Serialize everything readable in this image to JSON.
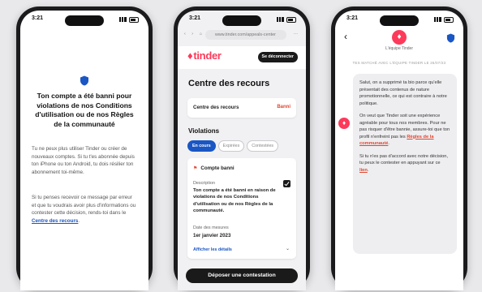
{
  "status": {
    "time": "3:21"
  },
  "phone1": {
    "title": "Ton compte a été banni pour violations de nos Conditions d'utilisation ou de nos Règles de la communauté",
    "para1": "Tu ne peux plus utiliser Tinder ou créer de nouveaux comptes. Si tu t'es abonnée depuis ton iPhone ou ton Android, tu dois résilier ton abonnement toi-même.",
    "para2_text": "Si tu penses recevoir ce message par erreur et que tu voudrais avoir plus d'informations ou contester cette décision, rends-toi dans le ",
    "para2_link": "Centre des recours",
    "para2_end": "."
  },
  "phone2": {
    "url": "www.tinder.com/appeals-center",
    "logo": "tinder",
    "logout_label": "Se déconnecter",
    "heading": "Centre des recours",
    "center_label": "Centre des recours",
    "center_status": "Banni",
    "violations_heading": "Violations",
    "tabs": [
      {
        "label": "En cours",
        "active": true
      },
      {
        "label": "Expirées",
        "active": false
      },
      {
        "label": "Contestées",
        "active": false
      }
    ],
    "ban": {
      "title": "Compte banni",
      "desc_label": "Description",
      "desc": "Ton compte a été banni en raison de violations de nos Conditions d'utilisation ou de nos Règles de la communauté.",
      "date_label": "Date des mesures",
      "date": "1er janvier 2023",
      "details_label": "Afficher les détails"
    },
    "appeal_button": "Déposer une contestation"
  },
  "phone3": {
    "name": "L'équipe Tinder",
    "matched": "TES MATCHÉ AVEC L'ÉQUIPE TINDER LE 26/07/23",
    "msg1": "Salut, on a supprimé ta bio parce qu'elle présentait des contenus de nature promotionnelle, ce qui est contraire à notre politique.",
    "msg2_text": "On veut que Tinder soit une expérience agréable pour tous nos membres. Pour ne pas risquer d'être bannie, assure-toi que ton profil n'enfreint pas les ",
    "msg2_link": "Règles de la communauté",
    "msg2_end": ".",
    "msg3_text": "Si tu n'es pas d'accord avec notre décision, tu peux le contester en appuyant sur ce ",
    "msg3_link": "lien",
    "msg3_end": "."
  },
  "colors": {
    "brand": "#fd3a5a",
    "link_blue": "#1a56c4",
    "danger": "#e0462f"
  }
}
